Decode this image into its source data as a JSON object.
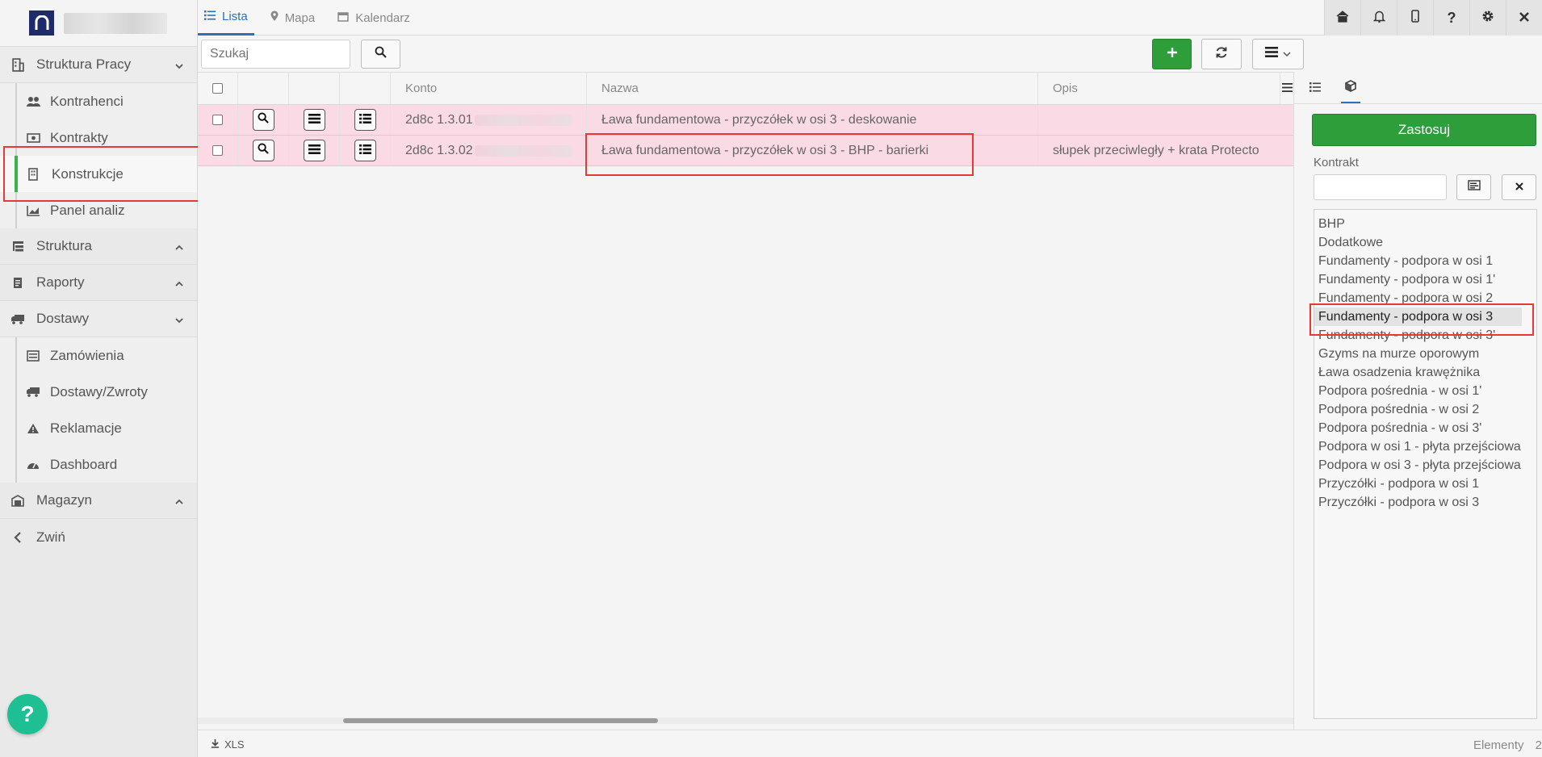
{
  "sidebar": {
    "items": [
      {
        "label": "Struktura Pracy",
        "icon": "building-icon",
        "expanded": true,
        "children": [
          {
            "label": "Kontrahenci",
            "icon": "users-icon"
          },
          {
            "label": "Kontrakty",
            "icon": "money-icon"
          },
          {
            "label": "Konstrukcje",
            "icon": "building-small-icon",
            "active": true
          },
          {
            "label": "Panel analiz",
            "icon": "chart-icon"
          }
        ]
      },
      {
        "label": "Struktura",
        "icon": "structure-icon",
        "expanded": false
      },
      {
        "label": "Raporty",
        "icon": "report-icon",
        "expanded": false
      },
      {
        "label": "Dostawy",
        "icon": "truck-icon",
        "expanded": true,
        "children": [
          {
            "label": "Zamówienia",
            "icon": "list-icon"
          },
          {
            "label": "Dostawy/Zwroty",
            "icon": "truck-icon"
          },
          {
            "label": "Reklamacje",
            "icon": "warning-icon"
          },
          {
            "label": "Dashboard",
            "icon": "gauge-icon"
          }
        ]
      },
      {
        "label": "Magazyn",
        "icon": "warehouse-icon",
        "expanded": false
      },
      {
        "label": "Zwiń",
        "icon": "chevron-left-icon"
      }
    ],
    "help": "?"
  },
  "tabs": [
    {
      "label": "Lista",
      "active": true
    },
    {
      "label": "Mapa",
      "active": false
    },
    {
      "label": "Kalendarz",
      "active": false
    }
  ],
  "toolbar": {
    "search_placeholder": "Szukaj"
  },
  "grid": {
    "columns": [
      "Konto",
      "Nazwa",
      "Opis"
    ],
    "rows": [
      {
        "konto": "2d8c 1.3.01",
        "nazwa": "Ława fundamentowa - przyczółek w osi 3 - deskowanie",
        "opis": ""
      },
      {
        "konto": "2d8c 1.3.02",
        "nazwa": "Ława fundamentowa - przyczółek w osi 3 - BHP - barierki",
        "opis": "słupek przeciwległy + krata Protecto"
      }
    ]
  },
  "filter": {
    "apply_label": "Zastosuj",
    "field_label": "Kontrakt",
    "options": [
      "BHP",
      "Dodatkowe",
      "Fundamenty - podpora w osi 1",
      "Fundamenty - podpora w osi 1'",
      "Fundamenty - podpora w osi 2",
      "Fundamenty - podpora w osi 3",
      "Fundamenty - podpora w osi 3'",
      "Gzyms na murze oporowym",
      "Ława osadzenia krawężnika",
      "Podpora pośrednia - w osi 1'",
      "Podpora pośrednia - w osi 2",
      "Podpora pośrednia - w osi 3'",
      "Podpora w osi 1 - płyta przejściowa",
      "Podpora w osi 3 - płyta przejściowa",
      "Przyczółki - podpora w osi 1",
      "Przyczółki - podpora w osi 3"
    ],
    "selected_index": 5
  },
  "footer": {
    "export_label": "XLS",
    "count_label": "Elementy",
    "count_value": "2"
  },
  "colors": {
    "accent": "#2e6fb8",
    "green": "#2d9e3a",
    "row_highlight": "#fadbe5",
    "active_bar": "#3cb24a",
    "annotation": "#e53935"
  }
}
